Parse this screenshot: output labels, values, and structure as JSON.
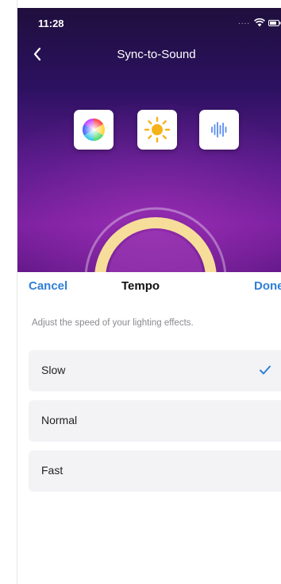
{
  "status_bar": {
    "time": "11:28",
    "signal_dots": "....",
    "wifi_icon": "wifi-icon",
    "battery_icon": "battery-icon"
  },
  "nav": {
    "title": "Sync-to-Sound",
    "back_icon": "chevron-left-icon"
  },
  "modes": [
    {
      "id": "color",
      "icon": "color-wheel-icon"
    },
    {
      "id": "brightness",
      "icon": "sun-icon"
    },
    {
      "id": "sound",
      "icon": "sound-wave-icon"
    }
  ],
  "sheet": {
    "cancel_label": "Cancel",
    "title": "Tempo",
    "done_label": "Done",
    "description": "Adjust the speed of your lighting effects.",
    "options": [
      {
        "label": "Slow",
        "selected": true
      },
      {
        "label": "Normal",
        "selected": false
      },
      {
        "label": "Fast",
        "selected": false
      }
    ]
  },
  "colors": {
    "accent": "#2f7fd6",
    "sun": "#f6b21b",
    "wave": "#5b8def",
    "ring": "#f7dd9a"
  }
}
